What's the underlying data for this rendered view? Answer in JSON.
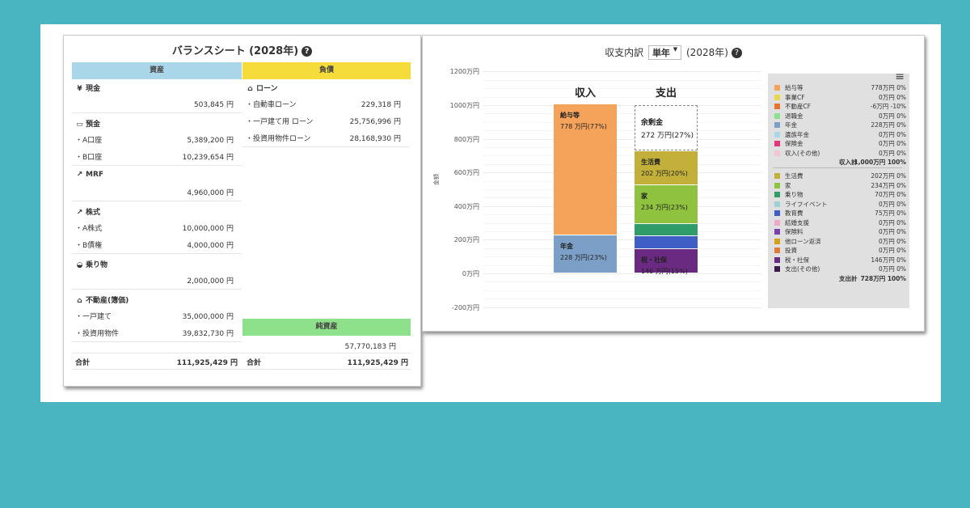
{
  "balance_sheet": {
    "title": "バランスシート (2028年)",
    "help_icon": "?",
    "assets_header": "資産",
    "liabilities_header": "負債",
    "net_assets_header": "純資産",
    "colors": {
      "assets": "#a9d6e8",
      "liabilities": "#f5dc3a",
      "net_assets": "#8fe08a"
    },
    "assets": [
      {
        "icon": "¥",
        "icon_name": "yen-icon",
        "label": "現金",
        "items": [
          {
            "label": "",
            "amount": "503,845 円"
          }
        ]
      },
      {
        "icon": "▭",
        "icon_name": "bank-card-icon",
        "label": "預金",
        "items": [
          {
            "label": "・A口座",
            "amount": "5,389,200 円"
          },
          {
            "label": "・B口座",
            "amount": "10,239,654 円"
          }
        ]
      },
      {
        "icon": "↗",
        "icon_name": "chart-line-icon",
        "label": "MRF",
        "items": [
          {
            "label": "",
            "amount": "4,960,000 円"
          }
        ]
      },
      {
        "icon": "↗",
        "icon_name": "chart-line-icon",
        "label": "株式",
        "items": [
          {
            "label": "・A株式",
            "amount": "10,000,000 円"
          },
          {
            "label": "・B債権",
            "amount": "4,000,000 円"
          }
        ]
      },
      {
        "icon": "◒",
        "icon_name": "car-icon",
        "label": "乗り物",
        "items": [
          {
            "label": "",
            "amount": "2,000,000 円"
          }
        ]
      },
      {
        "icon": "⌂",
        "icon_name": "house-icon",
        "label": "不動産(簿価)",
        "items": [
          {
            "label": "・一戸建て",
            "amount": "35,000,000 円"
          },
          {
            "label": "・投資用物件",
            "amount": "39,832,730 円"
          }
        ]
      }
    ],
    "liabilities": [
      {
        "icon": "⌂",
        "icon_name": "bank-icon",
        "label": "ローン",
        "items": [
          {
            "label": "・自動車ローン",
            "amount": "229,318 円"
          },
          {
            "label": "・一戸建て用 ローン",
            "amount": "25,756,996 円"
          },
          {
            "label": "・投資用物件ローン",
            "amount": "28,168,930 円"
          }
        ]
      }
    ],
    "net_assets_amount": "57,770,183 円",
    "total_label": "合計",
    "assets_total": "111,925,429 円",
    "liabilities_total": "111,925,429 円"
  },
  "cash_flow": {
    "title_prefix": "収支内訳",
    "period_select": "単年",
    "title_suffix": "(2028年)",
    "help_icon": "?",
    "menu_icon": "≡",
    "y_axis_label": "金額",
    "chart_data": {
      "type": "bar",
      "stacked": true,
      "categories": [
        "収入",
        "支出"
      ],
      "yticks": [
        "1200万円",
        "1000万円",
        "800万円",
        "600万円",
        "400万円",
        "200万円",
        "0万円",
        "-200万円"
      ],
      "ylim": [
        -200,
        1200
      ],
      "unit": "万円",
      "income_segments": [
        {
          "name": "年金",
          "value": 228,
          "label": "228 万円(23%)",
          "color": "#7b9fc7"
        },
        {
          "name": "給与等",
          "value": 778,
          "label": "778 万円(77%)",
          "color": "#f5a35b"
        }
      ],
      "expense_segments": [
        {
          "name": "税・社保",
          "value": 146,
          "label": "146 万円(15%)",
          "color": "#6a2a82"
        },
        {
          "name": "教育費",
          "value": 75,
          "label": "",
          "color": "#3f5fc6"
        },
        {
          "name": "乗り物",
          "value": 70,
          "label": "",
          "color": "#2f9c6a"
        },
        {
          "name": "家",
          "value": 234,
          "label": "234 万円(23%)",
          "color": "#8fc33f"
        },
        {
          "name": "生活費",
          "value": 202,
          "label": "202 万円(20%)",
          "color": "#c2b03a"
        },
        {
          "name": "余剰金",
          "value": 272,
          "label": "272 万円(27%)",
          "color": "#ffffff"
        }
      ]
    },
    "legend_income": [
      {
        "name": "給与等",
        "value": "778万円 0%",
        "color": "#f5a35b"
      },
      {
        "name": "事業CF",
        "value": "0万円 0%",
        "color": "#e8d84a"
      },
      {
        "name": "不動産CF",
        "value": "-6万円 -10%",
        "color": "#e8732a"
      },
      {
        "name": "退職金",
        "value": "0万円 0%",
        "color": "#8fe08a"
      },
      {
        "name": "年金",
        "value": "228万円 0%",
        "color": "#7b9fc7"
      },
      {
        "name": "遺族年金",
        "value": "0万円 0%",
        "color": "#a9d6e8"
      },
      {
        "name": "保険金",
        "value": "0万円 0%",
        "color": "#e8327a"
      },
      {
        "name": "収入(その他)",
        "value": "0万円 0%",
        "color": "#f4c4d6"
      }
    ],
    "income_total_label": "収入計",
    "income_total_value": "1,000万円 100%",
    "legend_expense": [
      {
        "name": "生活費",
        "value": "202万円 0%",
        "color": "#c2b03a"
      },
      {
        "name": "家",
        "value": "234万円 0%",
        "color": "#8fc33f"
      },
      {
        "name": "乗り物",
        "value": "70万円 0%",
        "color": "#2f9c6a"
      },
      {
        "name": "ライフイベント",
        "value": "0万円 0%",
        "color": "#9fd0d6"
      },
      {
        "name": "教育費",
        "value": "75万円 0%",
        "color": "#3f5fc6"
      },
      {
        "name": "結婚支援",
        "value": "0万円 0%",
        "color": "#f0a8c8"
      },
      {
        "name": "保険料",
        "value": "0万円 0%",
        "color": "#7a3fb0"
      },
      {
        "name": "他ローン返済",
        "value": "0万円 0%",
        "color": "#d4a018"
      },
      {
        "name": "投資",
        "value": "0万円 0%",
        "color": "#e07a3a"
      },
      {
        "name": "税・社保",
        "value": "146万円 0%",
        "color": "#6a2a82"
      },
      {
        "name": "支出(その他)",
        "value": "0万円 0%",
        "color": "#3a1a4a"
      }
    ],
    "expense_total_label": "支出計",
    "expense_total_value": "728万円 100%"
  }
}
